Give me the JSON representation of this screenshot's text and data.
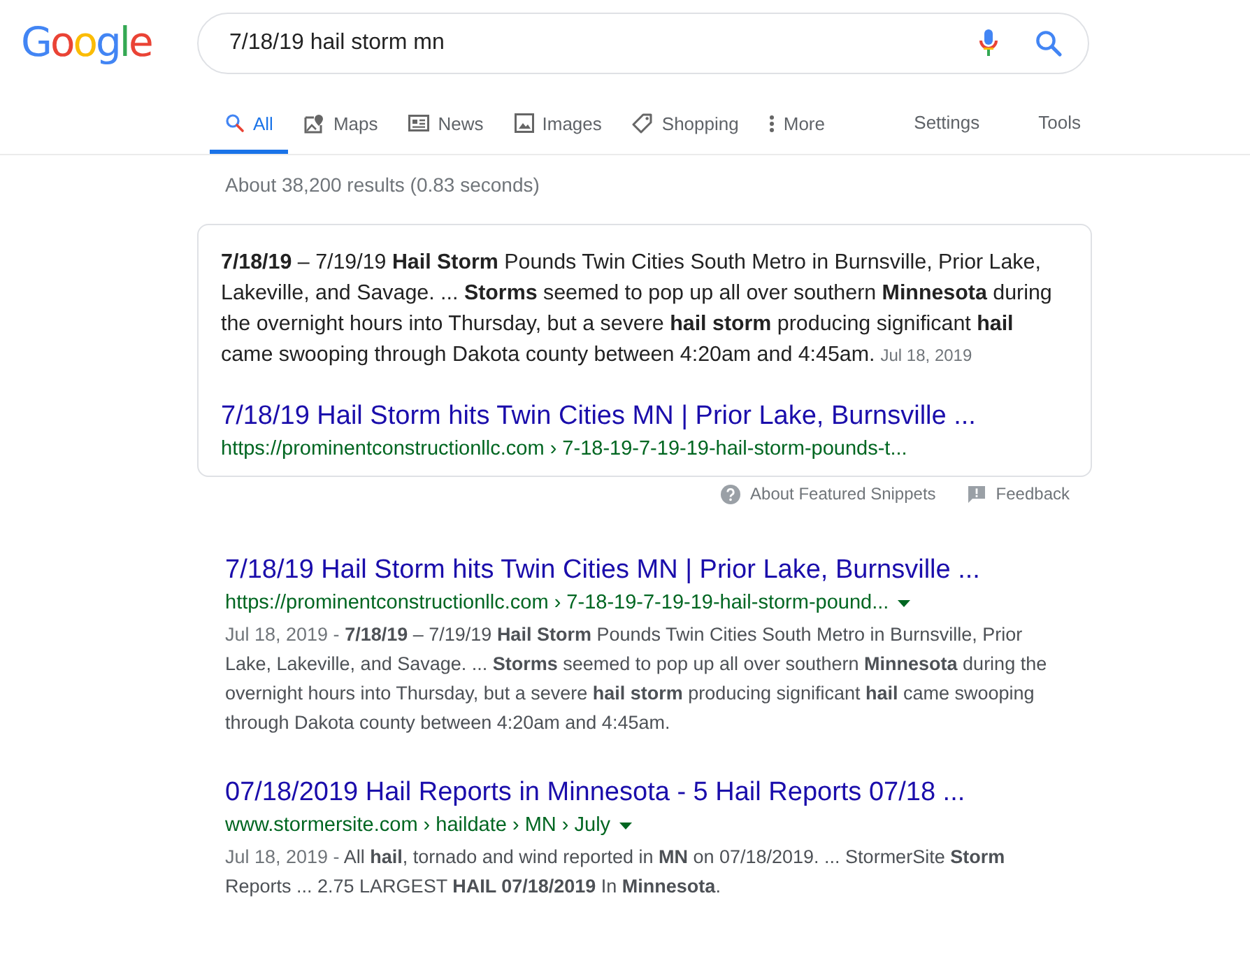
{
  "logo": "Google",
  "search": {
    "value": "7/18/19 hail storm mn"
  },
  "tabs": [
    {
      "label": "All",
      "selected": true
    },
    {
      "label": "Maps",
      "selected": false
    },
    {
      "label": "News",
      "selected": false
    },
    {
      "label": "Images",
      "selected": false
    },
    {
      "label": "Shopping",
      "selected": false
    },
    {
      "label": "More",
      "selected": false
    }
  ],
  "tools": [
    "Settings",
    "Tools"
  ],
  "result_stats": "About 38,200 results (0.83 seconds)",
  "featured": {
    "text": "**7/18/19** – 7/19/19 **Hail Storm** Pounds Twin Cities South Metro in Burnsville, Prior Lake, Lakeville, and Savage. ... **Storms** seemed to pop up all over southern **Minnesota** during the overnight hours into Thursday, but a severe **hail storm** producing significant **hail** came swooping through Dakota county between 4:20am and 4:45am.",
    "date": "Jul 18, 2019",
    "title": "7/18/19 Hail Storm hits Twin Cities MN | Prior Lake, Burnsville ...",
    "url": "https://prominentconstructionllc.com › 7-18-19-7-19-19-hail-storm-pounds-t..."
  },
  "featured_footer": {
    "about": "About Featured Snippets",
    "feedback": "Feedback"
  },
  "results": [
    {
      "title": "7/18/19 Hail Storm hits Twin Cities MN | Prior Lake, Burnsville ...",
      "url": "https://prominentconstructionllc.com › 7-18-19-7-19-19-hail-storm-pound...",
      "date": "Jul 18, 2019 -",
      "snippet": "**7/18/19** – 7/19/19 **Hail Storm** Pounds Twin Cities South Metro in Burnsville, Prior Lake, Lakeville, and Savage. ... **Storms** seemed to pop up all over southern **Minnesota** during the overnight hours into Thursday, but a severe **hail storm** producing significant **hail** came swooping through Dakota county between 4:20am and 4:45am."
    },
    {
      "title": "07/18/2019 Hail Reports in Minnesota - 5 Hail Reports 07/18 ...",
      "url": "www.stormersite.com › haildate › MN › July",
      "date": "Jul 18, 2019 -",
      "snippet": "All **hail**, tornado and wind reported in **MN** on 07/18/2019. ... StormerSite **Storm** Reports ... 2.75 LARGEST **HAIL 07/18/2019** In **Minnesota**."
    }
  ]
}
